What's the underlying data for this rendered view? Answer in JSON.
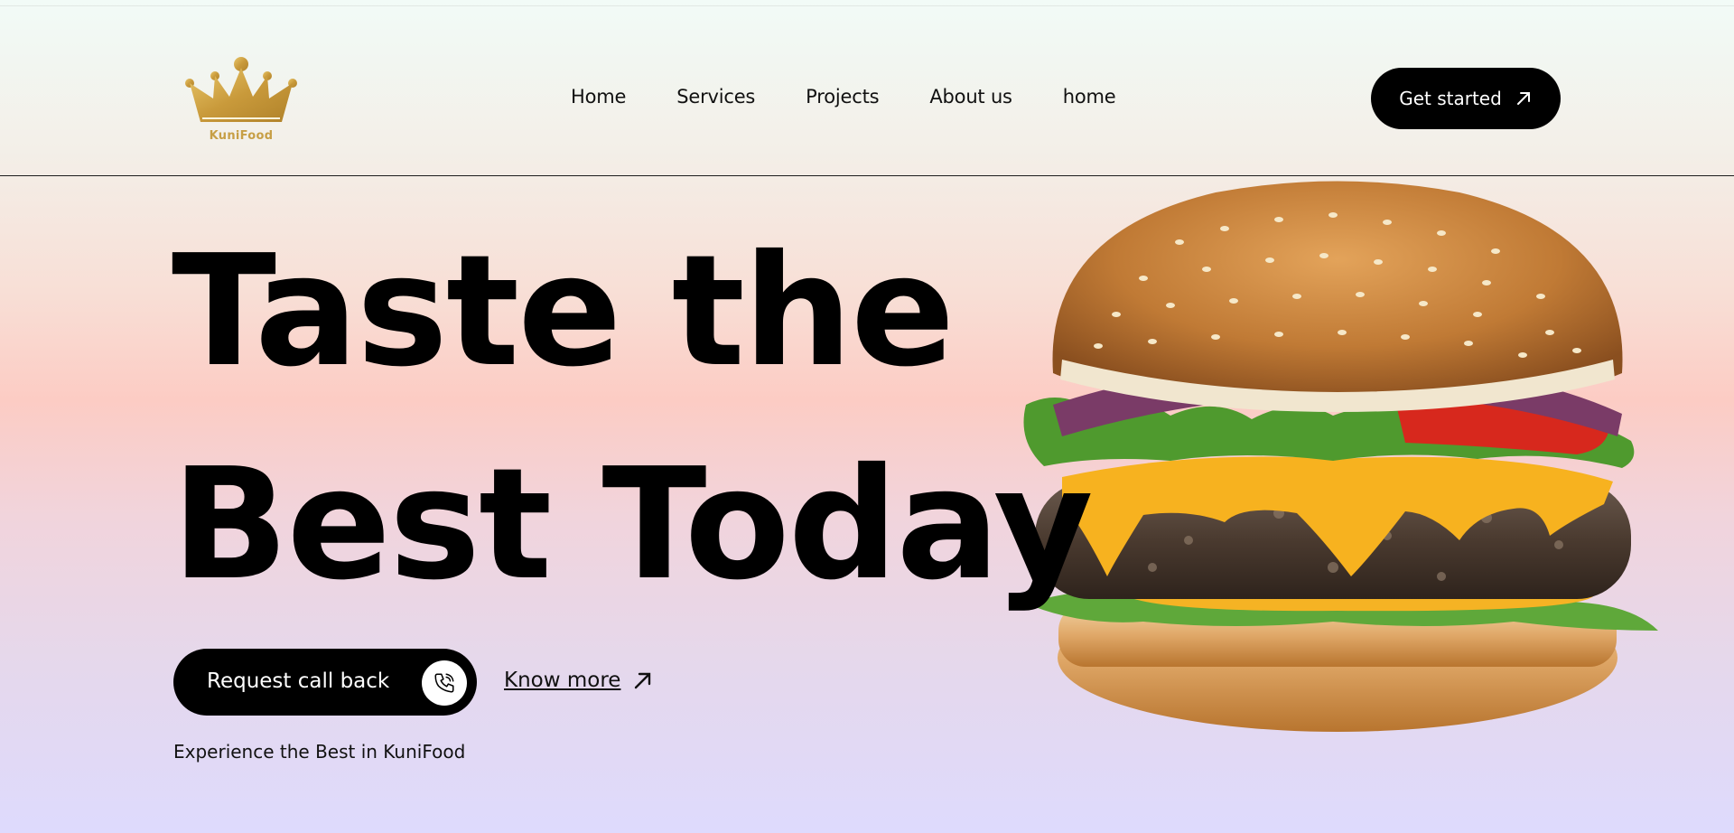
{
  "brand": {
    "logo_text": "KuniFood",
    "gold": "#c79f46"
  },
  "nav": {
    "items": [
      {
        "label": "Home"
      },
      {
        "label": "Services"
      },
      {
        "label": "Projects"
      },
      {
        "label": "About us"
      },
      {
        "label": "home"
      }
    ]
  },
  "header": {
    "cta_label": "Get started",
    "cta_icon": "arrow-up-right-icon"
  },
  "hero": {
    "line1": "Taste the",
    "line2": "Best Today",
    "call_button": "Request call back",
    "call_icon": "phone-icon",
    "know_more": "Know more",
    "know_more_icon": "arrow-up-right-icon",
    "tagline": "Experience the Best in KuniFood",
    "image": "burger-image"
  }
}
